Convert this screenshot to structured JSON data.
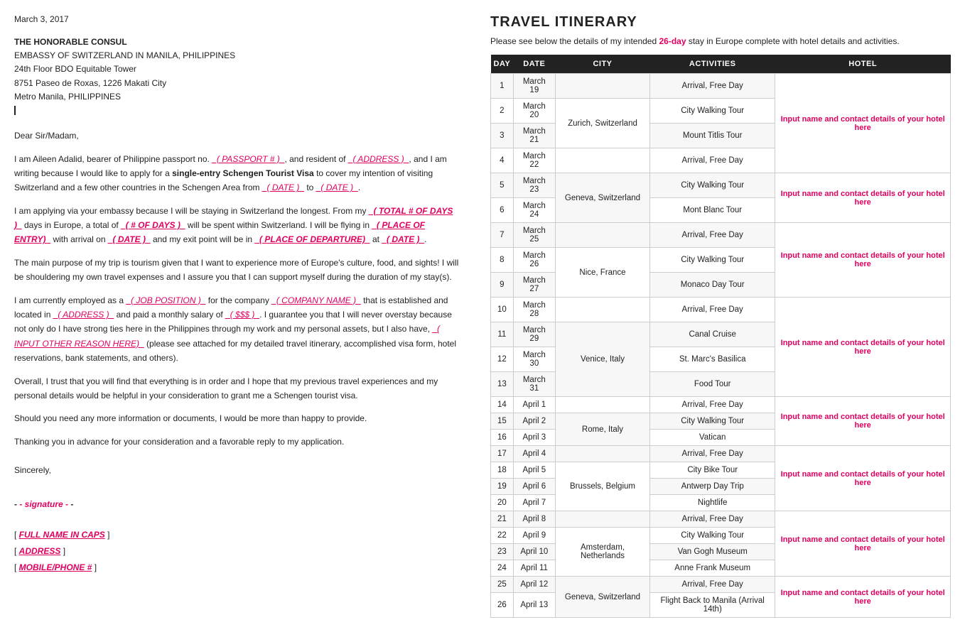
{
  "left": {
    "date": "March 3, 2017",
    "recipient_title": "THE HONORABLE CONSUL",
    "recipient_line1": "EMBASSY OF SWITZERLAND IN MANILA, PHILIPPINES",
    "recipient_line2": "24th Floor BDO Equitable Tower",
    "recipient_line3": "8751 Paseo de Roxas, 1226 Makati City",
    "recipient_line4": "Metro Manila, PHILIPPINES",
    "salutation": "Dear Sir/Madam,",
    "paragraph1_a": "I am Aileen Adalid, bearer of Philippine passport no. ",
    "paragraph1_passport": "_( PASSPORT # )_",
    "paragraph1_b": ", and resident of ",
    "paragraph1_address": "_( ADDRESS )_",
    "paragraph1_c": ", and I am writing because I would like to apply for a ",
    "paragraph1_bold": "single-entry Schengen Tourist Visa",
    "paragraph1_d": " to cover my intention of visiting Switzerland and a few other countries in the Schengen Area from ",
    "paragraph1_date1": "_( DATE )_",
    "paragraph1_e": " to ",
    "paragraph1_date2": "_( DATE )_",
    "paragraph1_f": ".",
    "paragraph2_a": "I am applying via your embassy because I will be staying in Switzerland the longest. From my ",
    "paragraph2_total": "_( TOTAL # OF DAYS )_",
    "paragraph2_b": " days in Europe, a total of ",
    "paragraph2_days": "_( # OF DAYS )_",
    "paragraph2_c": " will be spent within Switzerland. I will be flying in ",
    "paragraph2_place": "_( PLACE OF ENTRY)_",
    "paragraph2_d": " with arrival on ",
    "paragraph2_date": "_( DATE )_",
    "paragraph2_e": " and my exit point will be in ",
    "paragraph2_departure": "_( PLACE OF DEPARTURE)_",
    "paragraph2_f": " at ",
    "paragraph2_date2": "_( DATE )_",
    "paragraph2_g": ".",
    "paragraph3": "The main purpose of my trip is tourism given that I want to experience more of Europe's culture, food, and sights! I will be shouldering my own travel expenses and I assure you that I can support myself during the duration of my stay(s).",
    "paragraph4_a": "I am currently employed as a ",
    "paragraph4_job": "_( JOB POSITION )_",
    "paragraph4_b": " for the company ",
    "paragraph4_company": "_( COMPANY NAME )_",
    "paragraph4_c": " that is established and located in ",
    "paragraph4_address": "_( ADDRESS )_",
    "paragraph4_d": " and paid a monthly salary of ",
    "paragraph4_salary": "_( $$$ )_",
    "paragraph4_e": ". I guarantee you that I will never overstay because not only do I have strong ties here in the Philippines through my work and my personal assets, but I also have, ",
    "paragraph4_input": "_( INPUT OTHER REASON HERE)_",
    "paragraph4_f": " (please see attached for my detailed travel itinerary, accomplished visa form, hotel reservations, bank statements, and others).",
    "paragraph5": "Overall, I trust that you will find that everything is in order and I hope that my previous travel experiences and my personal details would be helpful in your consideration to grant me a Schengen tourist visa.",
    "paragraph6": "Should you need any more information or documents, I would be more than happy to provide.",
    "paragraph7": "Thanking you in advance for your consideration and a favorable reply to my application.",
    "sincerely": "Sincerely,",
    "signature": "- signature -",
    "footer_fullname_label": "[ ",
    "footer_fullname": "FULL NAME IN CAPS",
    "footer_fullname_end": " ]",
    "footer_address_label": "[ ",
    "footer_address": "ADDRESS",
    "footer_address_end": " ]",
    "footer_phone_label": "[ ",
    "footer_phone": "MOBILE/PHONE #",
    "footer_phone_end": " ]"
  },
  "right": {
    "title": "TRAVEL ITINERARY",
    "subtitle_a": "Please see below the details of my intended ",
    "subtitle_days": "26-day",
    "subtitle_b": " stay in Europe complete with hotel details and activities.",
    "columns": [
      "DAY",
      "DATE",
      "CITY",
      "ACTIVITIES",
      "HOTEL"
    ],
    "hotel_placeholder": "Input name and contact details of your hotel here",
    "rows": [
      {
        "day": "1",
        "date": "March 19",
        "city": "",
        "activity": "Arrival, Free Day",
        "hotel_group": 1
      },
      {
        "day": "2",
        "date": "March 20",
        "city": "Zurich, Switzerland",
        "activity": "City Walking Tour",
        "hotel_group": 1
      },
      {
        "day": "3",
        "date": "March 21",
        "city": "",
        "activity": "Mount Titlis Tour",
        "hotel_group": 1
      },
      {
        "day": "4",
        "date": "March 22",
        "city": "",
        "activity": "Arrival, Free Day",
        "hotel_group": 1
      },
      {
        "day": "5",
        "date": "March 23",
        "city": "Geneva, Switzerland",
        "activity": "City Walking Tour",
        "hotel_group": 2
      },
      {
        "day": "6",
        "date": "March 24",
        "city": "",
        "activity": "Mont Blanc Tour",
        "hotel_group": 2
      },
      {
        "day": "7",
        "date": "March 25",
        "city": "",
        "activity": "Arrival, Free Day",
        "hotel_group": 3
      },
      {
        "day": "8",
        "date": "March 26",
        "city": "Nice, France",
        "activity": "City Walking Tour",
        "hotel_group": 3
      },
      {
        "day": "9",
        "date": "March 27",
        "city": "",
        "activity": "Monaco Day Tour",
        "hotel_group": 3
      },
      {
        "day": "10",
        "date": "March 28",
        "city": "",
        "activity": "Arrival, Free Day",
        "hotel_group": 4
      },
      {
        "day": "11",
        "date": "March 29",
        "city": "Venice, Italy",
        "activity": "Canal Cruise",
        "hotel_group": 4
      },
      {
        "day": "12",
        "date": "March 30",
        "city": "",
        "activity": "St. Marc's Basilica",
        "hotel_group": 4
      },
      {
        "day": "13",
        "date": "March 31",
        "city": "",
        "activity": "Food Tour",
        "hotel_group": 4
      },
      {
        "day": "14",
        "date": "April 1",
        "city": "",
        "activity": "Arrival, Free Day",
        "hotel_group": 5
      },
      {
        "day": "15",
        "date": "April 2",
        "city": "Rome, Italy",
        "activity": "City Walking Tour",
        "hotel_group": 5
      },
      {
        "day": "16",
        "date": "April 3",
        "city": "",
        "activity": "Vatican",
        "hotel_group": 5
      },
      {
        "day": "17",
        "date": "April 4",
        "city": "",
        "activity": "Arrival, Free Day",
        "hotel_group": 6
      },
      {
        "day": "18",
        "date": "April 5",
        "city": "Brussels, Belgium",
        "activity": "City Bike Tour",
        "hotel_group": 6
      },
      {
        "day": "19",
        "date": "April 6",
        "city": "",
        "activity": "Antwerp Day Trip",
        "hotel_group": 6
      },
      {
        "day": "20",
        "date": "April 7",
        "city": "",
        "activity": "Nightlife",
        "hotel_group": 6
      },
      {
        "day": "21",
        "date": "April 8",
        "city": "",
        "activity": "Arrival, Free Day",
        "hotel_group": 7
      },
      {
        "day": "22",
        "date": "April 9",
        "city": "Amsterdam, Netherlands",
        "activity": "City Walking Tour",
        "hotel_group": 7
      },
      {
        "day": "23",
        "date": "April 10",
        "city": "",
        "activity": "Van Gogh Museum",
        "hotel_group": 7
      },
      {
        "day": "24",
        "date": "April 11",
        "city": "",
        "activity": "Anne Frank Museum",
        "hotel_group": 7
      },
      {
        "day": "25",
        "date": "April 12",
        "city": "Geneva, Switzerland",
        "activity": "Arrival, Free Day",
        "hotel_group": 8
      },
      {
        "day": "26",
        "date": "April 13",
        "city": "",
        "activity": "Flight Back to Manila (Arrival 14th)",
        "hotel_group": 8
      }
    ],
    "hotel_groups": {
      "1": {
        "rows": [
          1,
          2,
          3,
          4
        ],
        "rowspan": 4
      },
      "2": {
        "rows": [
          5,
          6
        ],
        "rowspan": 2
      },
      "3": {
        "rows": [
          7,
          8,
          9
        ],
        "rowspan": 3
      },
      "4": {
        "rows": [
          10,
          11,
          12,
          13
        ],
        "rowspan": 4
      },
      "5": {
        "rows": [
          14,
          15,
          16
        ],
        "rowspan": 3
      },
      "6": {
        "rows": [
          17,
          18,
          19,
          20
        ],
        "rowspan": 4
      },
      "7": {
        "rows": [
          21,
          22,
          23,
          24
        ],
        "rowspan": 4
      },
      "8": {
        "rows": [
          25,
          26
        ],
        "rowspan": 2
      }
    }
  }
}
